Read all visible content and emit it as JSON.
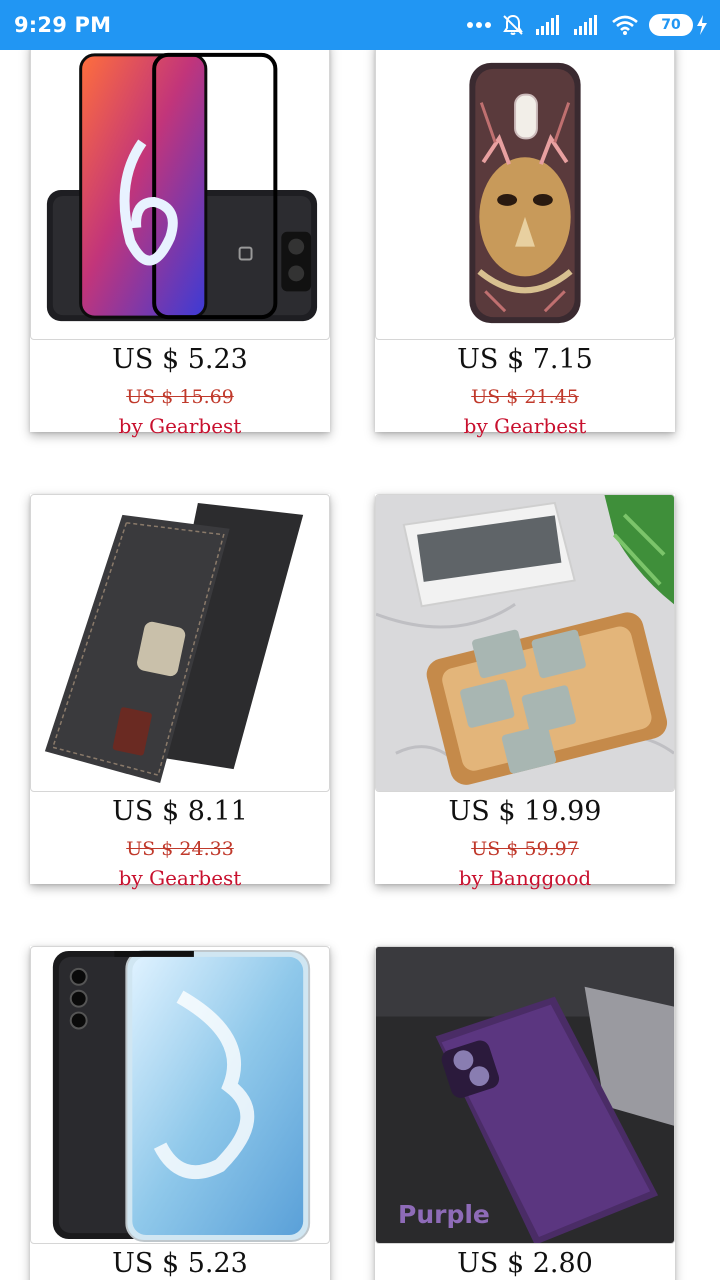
{
  "status_bar": {
    "time": "9:29 PM",
    "battery": "70",
    "icons": [
      "more-icon",
      "alarm-off-icon",
      "signal-icon",
      "signal-icon",
      "wifi-icon",
      "battery-icon",
      "charging-icon"
    ]
  },
  "products": [
    {
      "price": "US $ 5.23",
      "old_price": "US $ 15.69",
      "seller": "by Gearbest",
      "image": "screen-protector-phone"
    },
    {
      "price": "US $ 7.15",
      "old_price": "US $ 21.45",
      "seller": "by Gearbest",
      "image": "tiger-phone-case"
    },
    {
      "price": "US $ 8.11",
      "old_price": "US $ 24.33",
      "seller": "by Gearbest",
      "image": "flip-wallet-case"
    },
    {
      "price": "US $ 19.99",
      "old_price": "US $ 59.97",
      "seller": "by Banggood",
      "image": "cleaning-wipes"
    },
    {
      "price": "US $ 5.23",
      "old_price": "",
      "seller": "",
      "image": "huawei-phone-protector"
    },
    {
      "price": "US $ 2.80",
      "old_price": "",
      "seller": "",
      "image": "purple-phone-case",
      "caption": "Purple"
    }
  ],
  "colors": {
    "status_bar": "#2196f3",
    "seller_text": "#c8102e",
    "old_price_text": "#c0392b"
  }
}
